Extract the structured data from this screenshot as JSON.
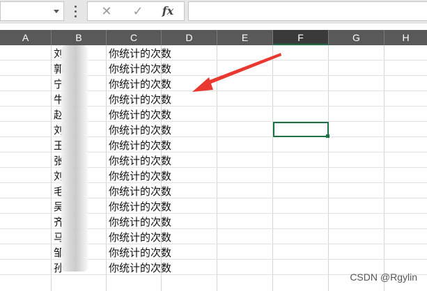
{
  "formula_bar": {
    "cancel_glyph": "✕",
    "enter_glyph": "✓",
    "fx_label": "fx"
  },
  "columns": [
    "A",
    "B",
    "C",
    "D",
    "E",
    "F",
    "G",
    "H"
  ],
  "active_column": "F",
  "rows": [
    {
      "b": "刘",
      "c": "你统计的次数"
    },
    {
      "b": "郭",
      "c": "你统计的次数"
    },
    {
      "b": "宁",
      "c": "你统计的次数"
    },
    {
      "b": "牛",
      "c": "你统计的次数"
    },
    {
      "b": "赵",
      "c": "你统计的次数"
    },
    {
      "b": "刘",
      "c": "你统计的次数"
    },
    {
      "b": "王",
      "c": "你统计的次数"
    },
    {
      "b": "张",
      "c": "你统计的次数"
    },
    {
      "b": "刘",
      "c": "你统计的次数"
    },
    {
      "b": "毛",
      "c": "你统计的次数"
    },
    {
      "b": "吴",
      "c": "你统计的次数"
    },
    {
      "b": "齐",
      "c": "你统计的次数"
    },
    {
      "b": "马",
      "c": "你统计的次数"
    },
    {
      "b": "邹",
      "c": "你统计的次数"
    },
    {
      "b": "孙",
      "c": "你统计的次数"
    }
  ],
  "colors": {
    "accent_green": "#1e7145",
    "arrow_red": "#e8382f",
    "header_bg": "#595959"
  },
  "watermark": "CSDN @Rgylin"
}
